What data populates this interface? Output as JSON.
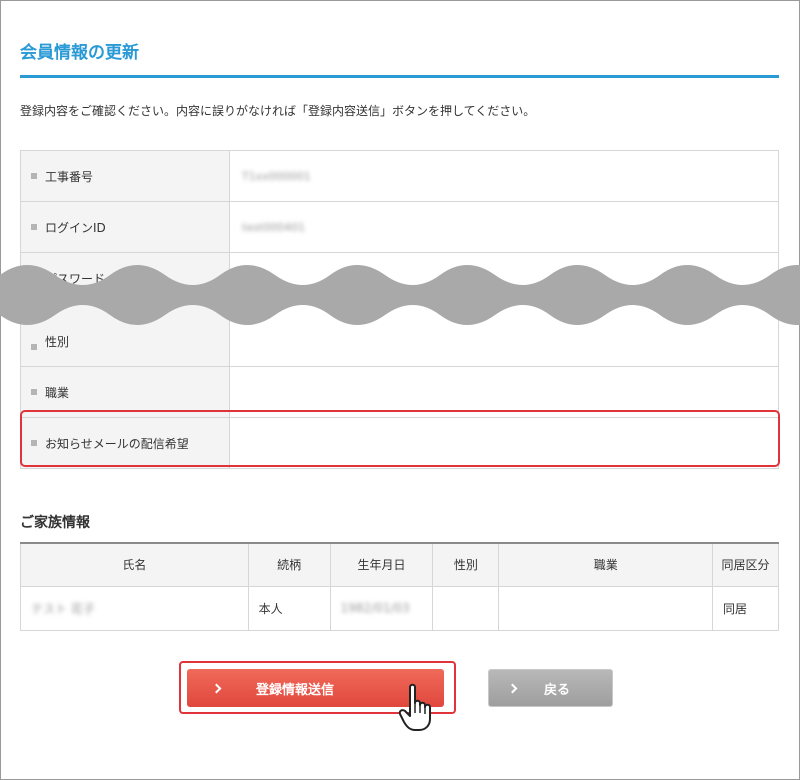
{
  "page": {
    "title": "会員情報の更新",
    "intro": "登録内容をご確認ください。内容に誤りがなければ「登録内容送信」ボタンを押してください。"
  },
  "member_info": {
    "rows": [
      {
        "label": "工事番号",
        "value": "T1xx000001"
      },
      {
        "label": "ログインID",
        "value": "test000401"
      },
      {
        "label": "パスワード",
        "value": ""
      },
      {
        "label": "性別",
        "value": ""
      },
      {
        "label": "職業",
        "value": ""
      },
      {
        "label": "お知らせメールの配信希望",
        "value": ""
      }
    ]
  },
  "family": {
    "title": "ご家族情報",
    "columns": [
      "氏名",
      "続柄",
      "生年月日",
      "性別",
      "職業",
      "同居区分"
    ],
    "rows": [
      {
        "name": "テスト 花子",
        "relation": "本人",
        "birth": "1982/01/03",
        "gender": "",
        "job": "",
        "living": "同居"
      }
    ]
  },
  "buttons": {
    "submit": "登録情報送信",
    "back": "戻る"
  },
  "colors": {
    "accent": "#2a9ad6",
    "highlight": "#e0343a",
    "submit": "#e0473d",
    "back": "#9e9e9e"
  }
}
